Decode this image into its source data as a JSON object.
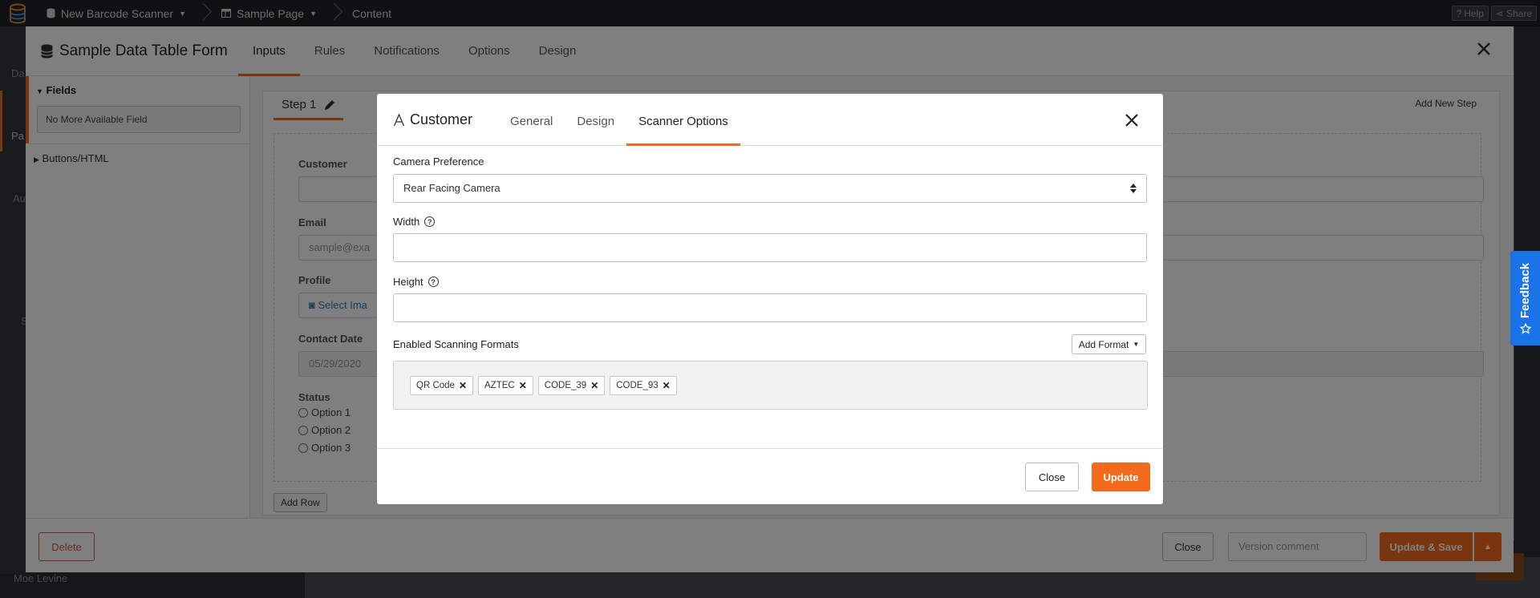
{
  "topbar": {
    "app_name": "New Barcode Scanner",
    "page_name": "Sample Page",
    "section": "Content",
    "help_label": "Help",
    "share_label": "Share"
  },
  "background": {
    "sidebar_fragments": [
      "Da",
      "Pa",
      "Au",
      "S"
    ],
    "user_name": "Moe Levine"
  },
  "form_modal": {
    "title": "Sample Data Table Form",
    "tabs": [
      "Inputs",
      "Rules",
      "Notifications",
      "Options",
      "Design"
    ],
    "active_tab": "Inputs",
    "fields_header": "Fields",
    "no_field_text": "No More Available Field",
    "buttons_header": "Buttons/HTML",
    "step_label": "Step 1",
    "add_step_label": "Add New Step",
    "fields": {
      "customer_label": "Customer",
      "email_label": "Email",
      "email_placeholder": "sample@exa",
      "profile_label": "Profile",
      "profile_button": "Select Ima",
      "contact_date_label": "Contact Date",
      "contact_date_value": "05/29/2020",
      "status_label": "Status",
      "status_options": [
        "Option 1",
        "Option 2",
        "Option 3"
      ]
    },
    "add_row_label": "Add Row",
    "footer": {
      "delete_label": "Delete",
      "close_label": "Close",
      "version_placeholder": "Version comment",
      "update_save_label": "Update & Save"
    }
  },
  "feedback_label": "Feedback",
  "dialog": {
    "title": "Customer",
    "tabs": [
      "General",
      "Design",
      "Scanner Options"
    ],
    "active_tab": "Scanner Options",
    "camera_label": "Camera Preference",
    "camera_value": "Rear Facing Camera",
    "width_label": "Width",
    "width_value": "",
    "height_label": "Height",
    "height_value": "",
    "formats_label": "Enabled Scanning Formats",
    "add_format_label": "Add Format",
    "formats": [
      "QR Code",
      "AZTEC",
      "CODE_39",
      "CODE_93"
    ],
    "close_label": "Close",
    "update_label": "Update"
  },
  "colors": {
    "accent": "#f26b1d",
    "topbar": "#1f2226",
    "feedback": "#1a73e8",
    "danger": "#d9534f"
  }
}
